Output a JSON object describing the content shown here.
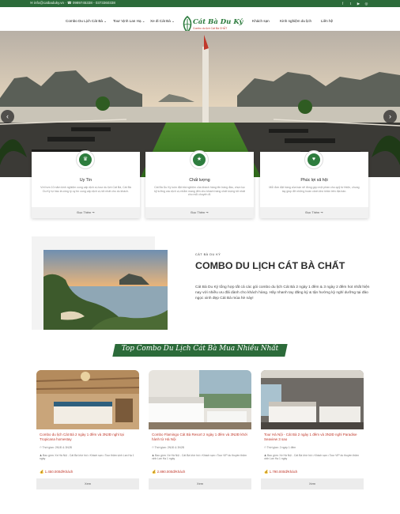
{
  "topbar": {
    "contact": "✉ info@catbaduky.vn  ·  ☎ 0989745338 - 0373360338",
    "social": [
      "f",
      "t",
      "▶",
      "◎"
    ]
  },
  "nav": {
    "items": [
      "Combo Du Lịch Cát Bà ⌄",
      "Tour Vịnh Lan Hạ ⌄",
      "Xe đi Cát Bà ⌄",
      "Khách sạn",
      "Kinh nghiệm du lịch",
      "Liên hệ"
    ]
  },
  "logo": {
    "name": "Cát Bà Du Ký",
    "tagline": "Combo du lịch Cát Bà CHẤT"
  },
  "hero": {
    "prev": "‹",
    "next": "›"
  },
  "features": [
    {
      "icon": "trophy-icon",
      "glyph": "♛",
      "title": "Uy Tín",
      "desc": "Với hơn 10 năm kinh nghiệm cung cấp dịch vụ tour du lịch Cát Bà, Cát Bà Du Ký tự hào là công ty uy tín cung cấp dịch vụ tốt nhất cho du khách.",
      "more": "Đọc Thêm  ➞"
    },
    {
      "icon": "star-icon",
      "glyph": "★",
      "title": "Chất lượng",
      "desc": "Cát Bà Du Ký luôn đặt trải nghiệm của khách hàng lên hàng đầu, chọn lọc kỹ lưỡng các dịch vụ nhằm mang đến cho khách hàng chất lượng tốt nhất cho mỗi chuyến đi.",
      "more": "Đọc Thêm  ➞"
    },
    {
      "icon": "heart-icon",
      "glyph": "♥",
      "title": "Phúc lợi xã hội",
      "desc": "Mỗi đơn đặt hàng của bạn sẽ đóng góp một phần cho quỹ từ thiện, chung tay giúp đỡ những hoàn cảnh khó khăn trên địa bàn.",
      "more": "Đọc Thêm  ➞"
    }
  ],
  "combo": {
    "small": "CÁT BÀ DU KÝ",
    "title": "COMBO DU LỊCH CÁT BÀ CHẤT",
    "text": "Cát Bà Du Ký tổng hợp tất cả các gói combo du lịch Cát Bà 2 ngày 1 đêm & 3 ngày 2 đêm hot nhất hiện nay với nhiều ưu đãi dành cho khách hàng. Hãy nhanh tay đăng ký & tận hưởng kỳ nghỉ dưỡng tại đảo ngọc xinh đẹp Cát Bà mùa hè này!"
  },
  "banner": {
    "text": "Top Combo Du Lịch Cát Bà Mua Nhiều Nhất"
  },
  "cards": [
    {
      "name": "Combo du lịch Cát Bà 2 ngày 1 đêm và 3N2Đ nghỉ tại Tropicana homestay",
      "time": "⏱ Thời gian: 2N1Đ & 3N2Đ",
      "route": "♟ Bao gồm: Xe Hà Nội - Cát Bà khứ hồi • Khách sạn • Tour thăm vịnh Lan Hạ 1 ngày",
      "price": "💰 1.450.000đ/Khách",
      "button": "Xem"
    },
    {
      "name": "Combo Flamingo Cát Bà Resort 2 ngày 1 đêm và 3N2Đ khởi hành từ Hà Nội",
      "time": "⏱ Thời gian: 2N1Đ & 3N2Đ",
      "route": "♟ Bao gồm: Xe Hà Nội - Cát Bà khứ hồi • Khách sạn • Tour VIP du thuyền thăm vịnh Lan Hạ 1 ngày",
      "price": "💰 2.890.000đ/Khách",
      "button": "Xem"
    },
    {
      "name": "Tour Hà Nội - Cát Bà 2 ngày 1 đêm và 3N2Đ nghỉ Paradise Seaview 3 sao",
      "time": "⏱ Thời gian: 2 ngày 1 đêm",
      "route": "♟ Bao gồm: Xe Hà Nội - Cát Bà khứ hồi • Khách sạn • Tour VIP du thuyền thăm vịnh Lan Hạ 1 ngày",
      "price": "💰 1.790.000đ/Khách",
      "button": "Xem"
    }
  ],
  "colors": {
    "brand_green": "#2c6b3a",
    "accent_red": "#c0392b"
  }
}
